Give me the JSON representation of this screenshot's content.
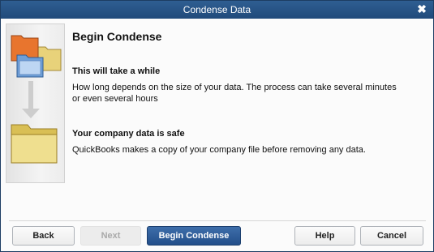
{
  "window": {
    "title": "Condense Data",
    "close_glyph": "✖"
  },
  "main": {
    "title": "Begin Condense",
    "sections": [
      {
        "heading": "This will take a while",
        "body_line1": "How long depends on the size of your data. The process can take several minutes",
        "body_line2": "or even several hours"
      },
      {
        "heading": "Your company data is safe",
        "body_line1": "QuickBooks makes a copy of your company file before removing any data."
      }
    ]
  },
  "illustration": {
    "icons": [
      "folder-stack-icon",
      "down-arrow-icon",
      "folder-icon"
    ],
    "colors": {
      "orange_folder": "#e8752e",
      "blue_folder": "#6f9fd8",
      "yellow_folder": "#e8d27a",
      "arrow": "#c9c9c9"
    }
  },
  "buttons": {
    "back": "Back",
    "next": "Next",
    "begin_condense": "Begin Condense",
    "help": "Help",
    "cancel": "Cancel"
  },
  "colors": {
    "titlebar": "#2a5689",
    "primary_button": "#2f5e98"
  }
}
